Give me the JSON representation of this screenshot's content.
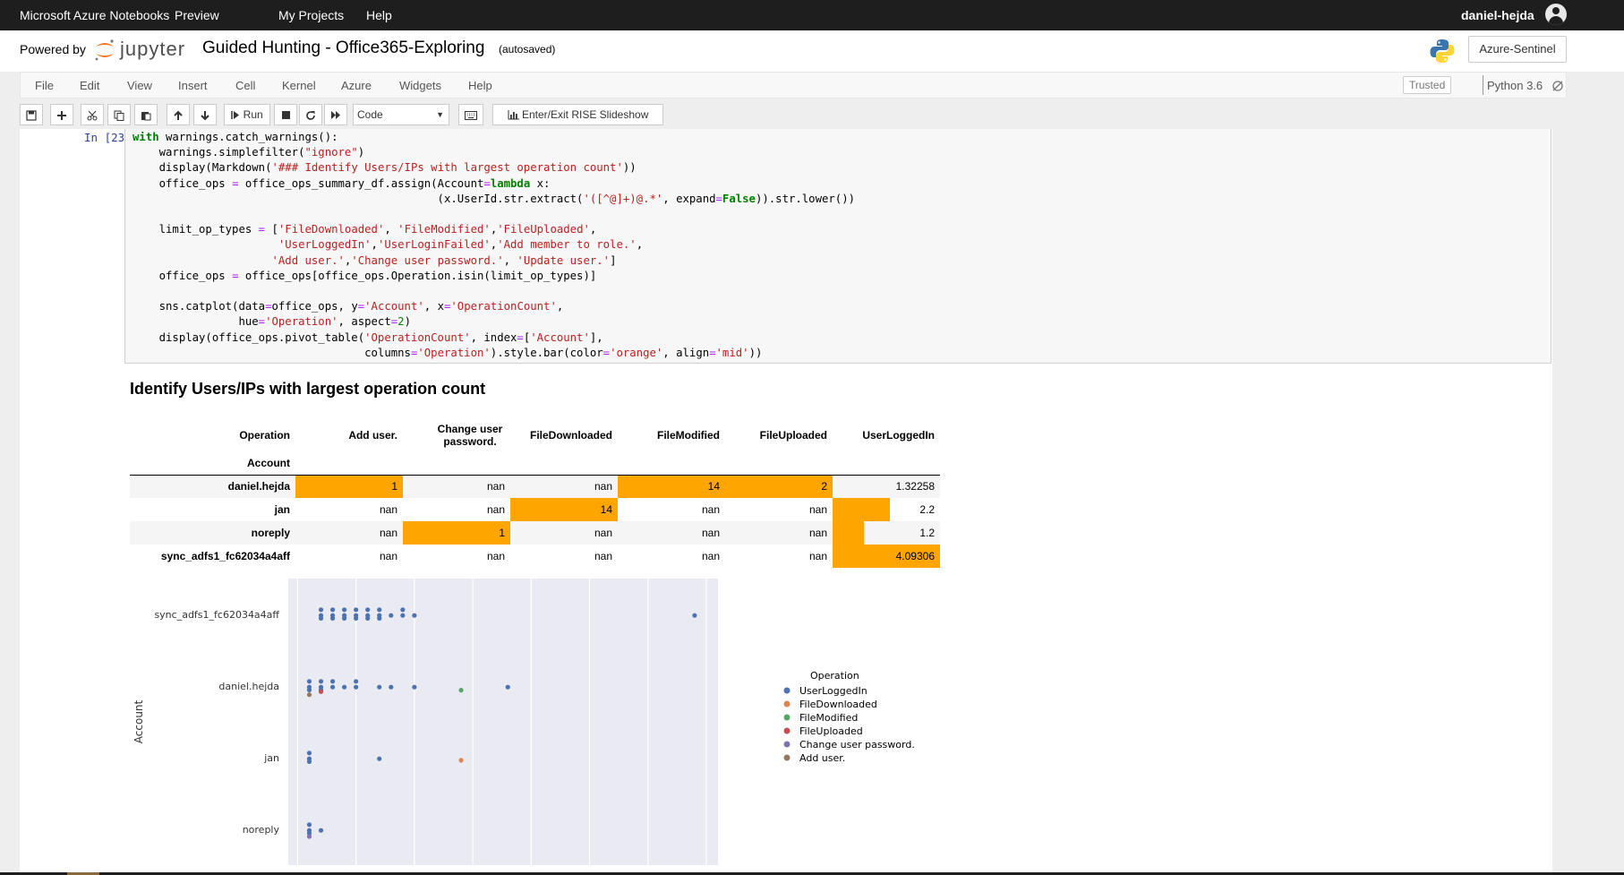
{
  "topbar": {
    "brand": "Microsoft Azure Notebooks",
    "preview": "Preview",
    "my_projects": "My Projects",
    "help": "Help",
    "user": "daniel-hejda"
  },
  "header": {
    "powered_by": "Powered by",
    "jupyter": "jupyter",
    "notebook_title": "Guided Hunting - Office365-Exploring",
    "save_status": "(autosaved)",
    "kernel_button": "Azure-Sentinel"
  },
  "menubar": {
    "items": [
      "File",
      "Edit",
      "View",
      "Insert",
      "Cell",
      "Kernel",
      "Azure",
      "Widgets",
      "Help"
    ],
    "trusted": "Trusted",
    "kernel_name": "Python 3.6"
  },
  "toolbar": {
    "run_label": "Run",
    "cell_type": "Code",
    "rise_label": "Enter/Exit RISE Slideshow"
  },
  "cell": {
    "prompt": "In [23]:",
    "markdown_title": "Identify Users/IPs with largest operation count"
  },
  "pivot_table": {
    "columns_label": "Operation",
    "index_label": "Account",
    "columns": [
      "Add user.",
      "Change user password.",
      "FileDownloaded",
      "FileModified",
      "FileUploaded",
      "UserLoggedIn"
    ],
    "rows": [
      {
        "account": "daniel.hejda",
        "cells": [
          "1",
          "nan",
          "nan",
          "14",
          "2",
          "1.32258"
        ],
        "bars": [
          1,
          0,
          0,
          1,
          1,
          0
        ]
      },
      {
        "account": "jan",
        "cells": [
          "nan",
          "nan",
          "14",
          "nan",
          "nan",
          "2.2"
        ],
        "bars": [
          0,
          0,
          1,
          0,
          0,
          0.53
        ]
      },
      {
        "account": "noreply",
        "cells": [
          "nan",
          "1",
          "nan",
          "nan",
          "nan",
          "1.2"
        ],
        "bars": [
          0,
          1,
          0,
          0,
          0,
          0.29
        ]
      },
      {
        "account": "sync_adfs1_fc62034a4aff",
        "cells": [
          "nan",
          "nan",
          "nan",
          "nan",
          "nan",
          "4.09306"
        ],
        "bars": [
          0,
          0,
          0,
          0,
          0,
          1
        ]
      }
    ]
  },
  "chart_data": {
    "type": "scatter",
    "ylabel": "Account",
    "categories": [
      "sync_adfs1_fc62034a4aff",
      "daniel.hejda",
      "jan",
      "noreply"
    ],
    "xticks": [
      0,
      5,
      10,
      15,
      20,
      25,
      30,
      35
    ],
    "xlim": [
      -0.8,
      36
    ],
    "grid": true,
    "legend": {
      "title": "Operation",
      "placement": "right"
    },
    "series": [
      {
        "name": "UserLoggedIn",
        "color": "#4c72b0",
        "points": [
          [
            2,
            0
          ],
          [
            2,
            0
          ],
          [
            2,
            0
          ],
          [
            3,
            0
          ],
          [
            3,
            0
          ],
          [
            3,
            0
          ],
          [
            4,
            0
          ],
          [
            4,
            0
          ],
          [
            4,
            0
          ],
          [
            5,
            0
          ],
          [
            5,
            0
          ],
          [
            5,
            0
          ],
          [
            6,
            0
          ],
          [
            6,
            0
          ],
          [
            6,
            0
          ],
          [
            7,
            0
          ],
          [
            7,
            0
          ],
          [
            7,
            0
          ],
          [
            8,
            0
          ],
          [
            9,
            0
          ],
          [
            9,
            0
          ],
          [
            10,
            0
          ],
          [
            34,
            0
          ],
          [
            1,
            1
          ],
          [
            1,
            1
          ],
          [
            1,
            1
          ],
          [
            2,
            1
          ],
          [
            2,
            1
          ],
          [
            2,
            1
          ],
          [
            3,
            1
          ],
          [
            3,
            1
          ],
          [
            4,
            1
          ],
          [
            5,
            1
          ],
          [
            5,
            1
          ],
          [
            7,
            1
          ],
          [
            8,
            1
          ],
          [
            10,
            1
          ],
          [
            18,
            1
          ],
          [
            1,
            2
          ],
          [
            1,
            2
          ],
          [
            1,
            2
          ],
          [
            7,
            2
          ],
          [
            1,
            3
          ],
          [
            1,
            3
          ],
          [
            1,
            3
          ],
          [
            2,
            3
          ]
        ]
      },
      {
        "name": "FileDownloaded",
        "color": "#dd8452",
        "points": [
          [
            14,
            2
          ]
        ]
      },
      {
        "name": "FileModified",
        "color": "#55a868",
        "points": [
          [
            14,
            1
          ]
        ]
      },
      {
        "name": "FileUploaded",
        "color": "#c44e52",
        "points": [
          [
            2,
            1
          ]
        ]
      },
      {
        "name": "Change user password.",
        "color": "#8172b3",
        "points": [
          [
            1,
            3
          ]
        ]
      },
      {
        "name": "Add user.",
        "color": "#937860",
        "points": [
          [
            1,
            1
          ]
        ]
      }
    ]
  }
}
